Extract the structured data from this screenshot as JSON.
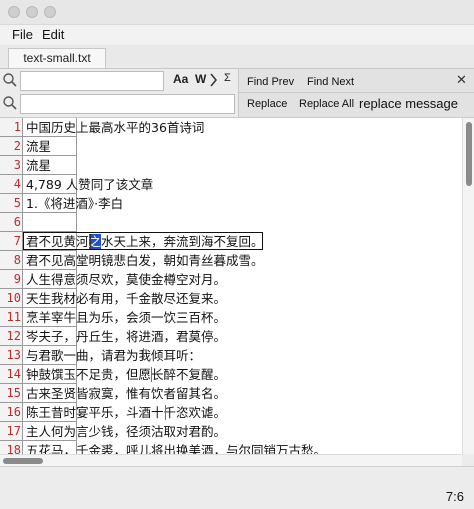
{
  "window": {
    "traffic_lights": [
      "close",
      "minimize",
      "zoom"
    ]
  },
  "menu": {
    "items": [
      "File",
      "Edit"
    ]
  },
  "tabs": [
    {
      "label": "text-small.txt"
    }
  ],
  "search": {
    "find_value": "",
    "replace_value": "",
    "case_label": "Aa",
    "word_label": "W",
    "regex_label": "Σ",
    "find_prev": "Find Prev",
    "find_next": "Find Next",
    "replace": "Replace",
    "replace_all": "Replace All",
    "message": "replace message",
    "close": "✕"
  },
  "editor": {
    "lines": [
      {
        "num": "1",
        "text": "中国历史上最高水平的36首诗词"
      },
      {
        "num": "2",
        "text": "流星"
      },
      {
        "num": "3",
        "text": "流星"
      },
      {
        "num": "4",
        "text": "4,789 人赞同了该文章"
      },
      {
        "num": "5",
        "text": "1.《将进酒》·李白"
      },
      {
        "num": "6",
        "text": ""
      },
      {
        "num": "7",
        "pre": "君不见黄河",
        "sel": "之",
        "post": "水天上来，奔流到海不复回。"
      },
      {
        "num": "8",
        "text": "君不见高堂明镜悲白发，朝如青丝暮成雪。"
      },
      {
        "num": "9",
        "text": "人生得意须尽欢，莫使金樽空对月。"
      },
      {
        "num": "10",
        "text": "天生我材必有用，千金散尽还复来。"
      },
      {
        "num": "11",
        "text": "烹羊宰牛且为乐，会须一饮三百杯。"
      },
      {
        "num": "12",
        "text": "岑夫子，丹丘生，将进酒，君莫停。"
      },
      {
        "num": "13",
        "text": "与君歌一曲，请君为我倾耳听："
      },
      {
        "num": "14",
        "text": "钟鼓馔玉不足贵，但愿长醉不复醒。"
      },
      {
        "num": "15",
        "text": "古来圣贤皆寂寞，惟有饮者留其名。"
      },
      {
        "num": "16",
        "text": "陈王昔时宴平乐，斗酒十千恣欢谑。"
      },
      {
        "num": "17",
        "text": "主人何为言少钱，径须沽取对君酌。"
      },
      {
        "num": "18",
        "text": "五花马，千金裘，呼儿将出换美酒，与尔同销万古愁。"
      }
    ]
  },
  "status": {
    "position": "7:6"
  }
}
